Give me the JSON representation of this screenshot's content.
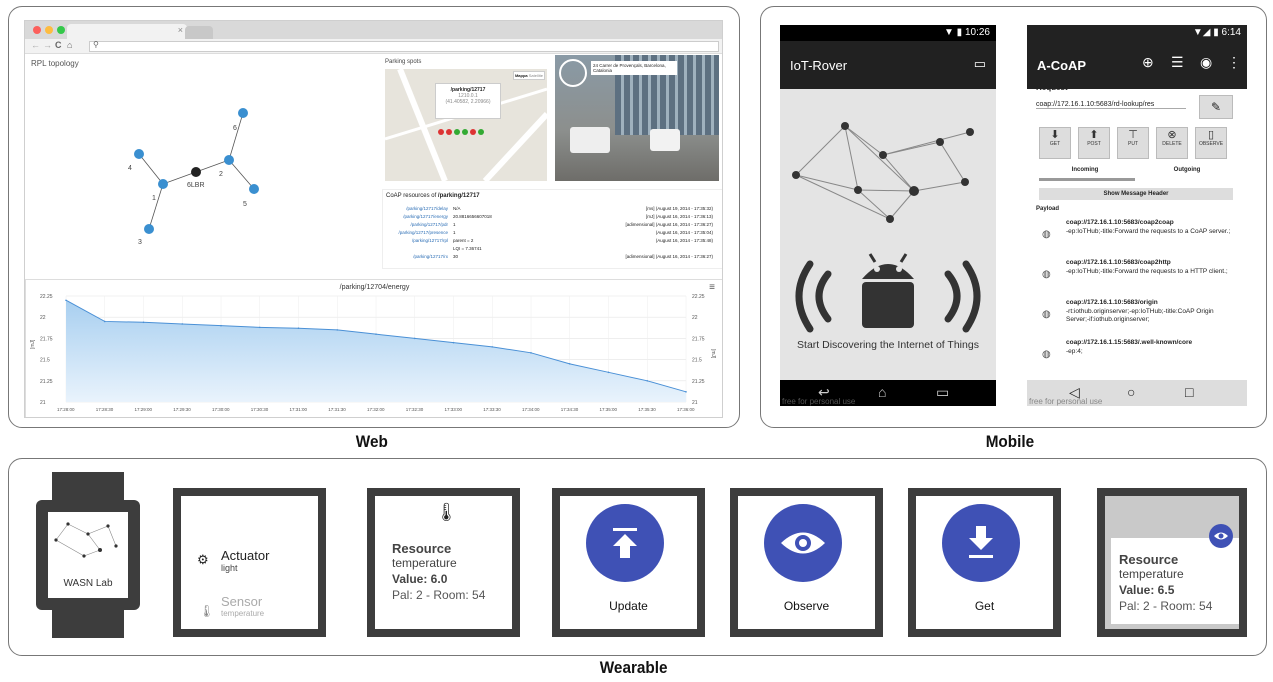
{
  "captions": {
    "web": "Web",
    "mobile": "Mobile",
    "wearable": "Wearable"
  },
  "web": {
    "rpl_title": "RPL topology",
    "nodes": [
      "6",
      "4",
      "2",
      "1",
      "6LBR",
      "5",
      "3"
    ],
    "parking_title": "Parking spots",
    "map_popup": {
      "title": "/parking/12717",
      "line1": "1210.0.1",
      "line2": "(41.40582, 2.20966)"
    },
    "map_buttons": [
      "Mappa",
      "Satellite"
    ],
    "street_address": "24 Carrer de Provençals, Barcelona, Catalonia",
    "coap_title_prefix": "CoAP resources of ",
    "coap_title_res": "/parking/12717",
    "coap_rows": [
      {
        "res": "/parking/12717/delay",
        "val": "N/A",
        "ts": "[ms] (August 19, 2014 - 17:35:32)"
      },
      {
        "res": "/parking/12717/energy",
        "val": "20.8816656607018",
        "ts": "[mJ] (August 16, 2014 - 17:36:13)"
      },
      {
        "res": "/parking/12717/pdr",
        "val": "1",
        "ts": "[adimensional] (August 16, 2014 - 17:36:27)"
      },
      {
        "res": "/parking/12717/presence",
        "val": "1",
        "ts": "(August 16, 2014 - 17:35:04)"
      },
      {
        "res": "/parking/12717/rpl",
        "val": "parent = 2",
        "ts": "(August 16, 2014 - 17:35:48)"
      },
      {
        "res": "",
        "val": "LQI = 7.36741",
        "ts": ""
      },
      {
        "res": "/parking/12717/rx",
        "val": "30",
        "ts": "[adimensional] (August 16, 2014 - 17:36:27)"
      }
    ],
    "chart_title": "/parking/12704/energy",
    "menu_icon": "≡",
    "y_left": [
      "22.25",
      "22",
      "21.75",
      "21.5",
      "21.25",
      "21"
    ],
    "y_right": [
      "22.25",
      "22",
      "21.75",
      "21.5",
      "21.25",
      "21"
    ],
    "y_unit": "[mJ]",
    "x_ticks": [
      "17:28:00",
      "17:28:30",
      "17:29:00",
      "17:29:30",
      "17:30:00",
      "17:30:30",
      "17:31:00",
      "17:31:30",
      "17:32:00",
      "17:32:30",
      "17:33:00",
      "17:33:30",
      "17:34:00",
      "17:34:30",
      "17:35:00",
      "17:35:30",
      "17:36:00"
    ]
  },
  "mobile1": {
    "time": "10:26",
    "title": "IoT-Rover",
    "tagline": "Start Discovering the Internet of Things",
    "watermark": "free for personal use"
  },
  "mobile2": {
    "time": "6:14",
    "title": "A-CoAP",
    "request_label": "Request",
    "url": "coap://172.16.1.10:5683/rd-lookup/res",
    "buttons": [
      "GET",
      "POST",
      "PUT",
      "DELETE",
      "OBSERVE"
    ],
    "tabs": [
      "Incoming",
      "Outgoing"
    ],
    "show_header": "Show Message Header",
    "payload_label": "Payload",
    "entries": [
      {
        "url": "coap://172.16.1.10:5683/coap2coap",
        "desc": "-ep:IoTHub;-title:Forward the requests to a CoAP server.;"
      },
      {
        "url": "coap://172.16.1.10:5683/coap2http",
        "desc": "-ep:IoTHub;-title:Forward the requests to a HTTP client.;"
      },
      {
        "url": "coap://172.16.1.10:5683/origin",
        "desc": "-rt:iothub.originserver;-ep:IoTHub;-title:CoAP Origin Server;-if:iothub.originserver;"
      },
      {
        "url": "coap://172.16.1.15:5683/.well-known/core",
        "desc": "-ep:4;"
      }
    ],
    "watermark": "free for personal use"
  },
  "wear": {
    "logo": "WASN Lab",
    "actuator": "Actuator",
    "actuator_sub": "light",
    "sensor": "Sensor",
    "sensor_sub": "temperature",
    "res1": {
      "title": "Resource",
      "name": "temperature",
      "value": "Value: 6.0",
      "loc": "Pal: 2 - Room: 54"
    },
    "update": "Update",
    "observe": "Observe",
    "get": "Get",
    "res2": {
      "title": "Resource",
      "name": "temperature",
      "value": "Value: 6.5",
      "loc": "Pal: 2 - Room: 54"
    }
  },
  "colors": {
    "accent": "#3f51b5",
    "android_green": "#a4c639",
    "chart_fill": "#a8cff0",
    "link": "#2a6db5"
  },
  "chart_data": {
    "type": "area",
    "title": "/parking/12704/energy",
    "ylabel": "[mJ]",
    "ylim": [
      21,
      22.25
    ],
    "x": [
      "17:28:00",
      "17:28:30",
      "17:29:00",
      "17:29:30",
      "17:30:00",
      "17:30:30",
      "17:31:00",
      "17:31:30",
      "17:32:00",
      "17:32:30",
      "17:33:00",
      "17:33:30",
      "17:34:00",
      "17:34:30",
      "17:35:00",
      "17:35:30",
      "17:36:00"
    ],
    "values": [
      22.2,
      21.95,
      21.94,
      21.92,
      21.9,
      21.88,
      21.87,
      21.85,
      21.8,
      21.75,
      21.7,
      21.65,
      21.58,
      21.45,
      21.35,
      21.25,
      21.12
    ]
  }
}
